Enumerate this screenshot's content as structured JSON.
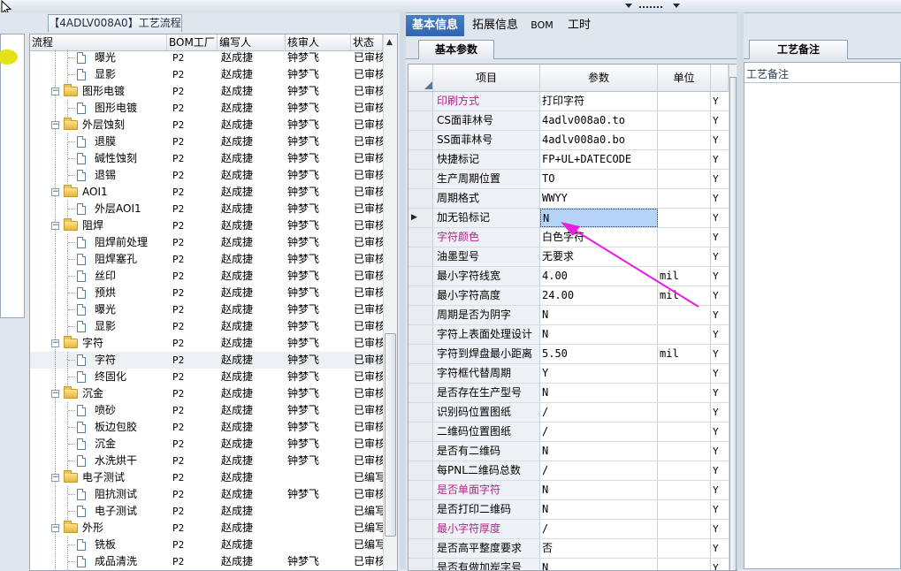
{
  "tree_caption": "【4ADLV008A0】工艺流程",
  "left_columns": [
    "流程",
    "BOM工厂",
    "编写人",
    "核审人",
    "状态"
  ],
  "tree_rows": [
    {
      "name": "曝光",
      "level": 2,
      "type": "doc",
      "bom": "P2",
      "writer": "赵成捷",
      "reviewer": "钟梦飞",
      "status": "已审核"
    },
    {
      "name": "显影",
      "level": 2,
      "type": "doc",
      "bom": "P2",
      "writer": "赵成捷",
      "reviewer": "钟梦飞",
      "status": "已审核"
    },
    {
      "name": "图形电镀",
      "level": 1,
      "type": "folder",
      "bom": "P2",
      "writer": "赵成捷",
      "reviewer": "钟梦飞",
      "status": "已审核"
    },
    {
      "name": "图形电镀",
      "level": 2,
      "type": "doc",
      "bom": "P2",
      "writer": "赵成捷",
      "reviewer": "钟梦飞",
      "status": "已审核"
    },
    {
      "name": "外层蚀刻",
      "level": 1,
      "type": "folder",
      "bom": "P2",
      "writer": "赵成捷",
      "reviewer": "钟梦飞",
      "status": "已审核"
    },
    {
      "name": "退膜",
      "level": 2,
      "type": "doc",
      "bom": "P2",
      "writer": "赵成捷",
      "reviewer": "钟梦飞",
      "status": "已审核"
    },
    {
      "name": "碱性蚀刻",
      "level": 2,
      "type": "doc",
      "bom": "P2",
      "writer": "赵成捷",
      "reviewer": "钟梦飞",
      "status": "已审核"
    },
    {
      "name": "退锡",
      "level": 2,
      "type": "doc",
      "bom": "P2",
      "writer": "赵成捷",
      "reviewer": "钟梦飞",
      "status": "已审核"
    },
    {
      "name": "AOI1",
      "level": 1,
      "type": "folder",
      "bom": "P2",
      "writer": "赵成捷",
      "reviewer": "钟梦飞",
      "status": "已审核"
    },
    {
      "name": "外层AOI1",
      "level": 2,
      "type": "doc",
      "bom": "P2",
      "writer": "赵成捷",
      "reviewer": "钟梦飞",
      "status": "已审核"
    },
    {
      "name": "阻焊",
      "level": 1,
      "type": "folder",
      "bom": "P2",
      "writer": "赵成捷",
      "reviewer": "钟梦飞",
      "status": "已审核"
    },
    {
      "name": "阻焊前处理",
      "level": 2,
      "type": "doc",
      "bom": "P2",
      "writer": "赵成捷",
      "reviewer": "钟梦飞",
      "status": "已审核"
    },
    {
      "name": "阻焊塞孔",
      "level": 2,
      "type": "doc",
      "bom": "P2",
      "writer": "赵成捷",
      "reviewer": "钟梦飞",
      "status": "已审核"
    },
    {
      "name": "丝印",
      "level": 2,
      "type": "doc",
      "bom": "P2",
      "writer": "赵成捷",
      "reviewer": "钟梦飞",
      "status": "已审核"
    },
    {
      "name": "预烘",
      "level": 2,
      "type": "doc",
      "bom": "P2",
      "writer": "赵成捷",
      "reviewer": "钟梦飞",
      "status": "已审核"
    },
    {
      "name": "曝光",
      "level": 2,
      "type": "doc",
      "bom": "P2",
      "writer": "赵成捷",
      "reviewer": "钟梦飞",
      "status": "已审核"
    },
    {
      "name": "显影",
      "level": 2,
      "type": "doc",
      "bom": "P2",
      "writer": "赵成捷",
      "reviewer": "钟梦飞",
      "status": "已审核"
    },
    {
      "name": "字符",
      "level": 1,
      "type": "folder",
      "bom": "P2",
      "writer": "赵成捷",
      "reviewer": "钟梦飞",
      "status": "已审核"
    },
    {
      "name": "字符",
      "level": 2,
      "type": "doc",
      "bom": "P2",
      "writer": "赵成捷",
      "reviewer": "钟梦飞",
      "status": "已审核",
      "selected": true
    },
    {
      "name": "终固化",
      "level": 2,
      "type": "doc",
      "bom": "P2",
      "writer": "赵成捷",
      "reviewer": "钟梦飞",
      "status": "已审核"
    },
    {
      "name": "沉金",
      "level": 1,
      "type": "folder",
      "bom": "P2",
      "writer": "赵成捷",
      "reviewer": "钟梦飞",
      "status": "已审核"
    },
    {
      "name": "喷砂",
      "level": 2,
      "type": "doc",
      "bom": "P2",
      "writer": "赵成捷",
      "reviewer": "钟梦飞",
      "status": "已审核"
    },
    {
      "name": "板边包胶",
      "level": 2,
      "type": "doc",
      "bom": "P2",
      "writer": "赵成捷",
      "reviewer": "钟梦飞",
      "status": "已审核"
    },
    {
      "name": "沉金",
      "level": 2,
      "type": "doc",
      "bom": "P2",
      "writer": "赵成捷",
      "reviewer": "钟梦飞",
      "status": "已审核"
    },
    {
      "name": "水洗烘干",
      "level": 2,
      "type": "doc",
      "bom": "P2",
      "writer": "赵成捷",
      "reviewer": "钟梦飞",
      "status": "已审核"
    },
    {
      "name": "电子测试",
      "level": 1,
      "type": "folder",
      "bom": "P2",
      "writer": "赵成捷",
      "reviewer": "",
      "status": "已编写"
    },
    {
      "name": "阻抗测试",
      "level": 2,
      "type": "doc",
      "bom": "P2",
      "writer": "赵成捷",
      "reviewer": "钟梦飞",
      "status": "已审核"
    },
    {
      "name": "电子测试",
      "level": 2,
      "type": "doc",
      "bom": "P2",
      "writer": "赵成捷",
      "reviewer": "",
      "status": "已编写"
    },
    {
      "name": "外形",
      "level": 1,
      "type": "folder",
      "bom": "P2",
      "writer": "赵成捷",
      "reviewer": "",
      "status": "已编写"
    },
    {
      "name": "铣板",
      "level": 2,
      "type": "doc",
      "bom": "P2",
      "writer": "赵成捷",
      "reviewer": "",
      "status": "已编写"
    },
    {
      "name": "成品清洗",
      "level": 2,
      "type": "doc",
      "bom": "P2",
      "writer": "赵成捷",
      "reviewer": "钟梦飞",
      "status": "已审核"
    }
  ],
  "main_tabs": [
    "基本信息",
    "拓展信息",
    "BOM",
    "工时"
  ],
  "sub_tab": "基本参数",
  "param_columns": [
    "项目",
    "参数",
    "单位"
  ],
  "params": [
    {
      "name": "印刷方式",
      "value": "打印字符",
      "unit": "",
      "flag": "Y",
      "pink": true,
      "mono": false
    },
    {
      "name": "CS面菲林号",
      "value": "4adlv008a0.to",
      "unit": "",
      "flag": "Y",
      "pink": false,
      "mono": true
    },
    {
      "name": "SS面菲林号",
      "value": "4adlv008a0.bo",
      "unit": "",
      "flag": "Y",
      "pink": false,
      "mono": true
    },
    {
      "name": "快捷标记",
      "value": "FP+UL+DATECODE",
      "unit": "",
      "flag": "Y",
      "pink": false,
      "mono": true
    },
    {
      "name": "生产周期位置",
      "value": "TO",
      "unit": "",
      "flag": "Y",
      "pink": false,
      "mono": true
    },
    {
      "name": "周期格式",
      "value": "WWYY",
      "unit": "",
      "flag": "Y",
      "pink": false,
      "mono": true
    },
    {
      "name": "加无铅标记",
      "value": "N",
      "unit": "",
      "flag": "Y",
      "pink": false,
      "mono": true,
      "selected": true
    },
    {
      "name": "字符颜色",
      "value": "白色字符",
      "unit": "",
      "flag": "Y",
      "pink": true,
      "mono": false
    },
    {
      "name": "油墨型号",
      "value": "无要求",
      "unit": "",
      "flag": "Y",
      "pink": false,
      "mono": false
    },
    {
      "name": "最小字符线宽",
      "value": "4.00",
      "unit": "mil",
      "flag": "Y",
      "pink": false,
      "mono": true
    },
    {
      "name": "最小字符高度",
      "value": "24.00",
      "unit": "mil",
      "flag": "Y",
      "pink": false,
      "mono": true
    },
    {
      "name": "周期是否为阴字",
      "value": "N",
      "unit": "",
      "flag": "Y",
      "pink": false,
      "mono": true
    },
    {
      "name": "字符上表面处理设计",
      "value": "N",
      "unit": "",
      "flag": "Y",
      "pink": false,
      "mono": true
    },
    {
      "name": "字符到焊盘最小距离",
      "value": "5.50",
      "unit": "mil",
      "flag": "Y",
      "pink": false,
      "mono": true
    },
    {
      "name": "字符框代替周期",
      "value": "Y",
      "unit": "",
      "flag": "Y",
      "pink": false,
      "mono": true
    },
    {
      "name": "是否存在生产型号",
      "value": "N",
      "unit": "",
      "flag": "Y",
      "pink": false,
      "mono": true
    },
    {
      "name": "识别码位置图纸",
      "value": "/",
      "unit": "",
      "flag": "Y",
      "pink": false,
      "mono": true
    },
    {
      "name": "二维码位置图纸",
      "value": "/",
      "unit": "",
      "flag": "Y",
      "pink": false,
      "mono": true
    },
    {
      "name": "是否有二维码",
      "value": "N",
      "unit": "",
      "flag": "Y",
      "pink": false,
      "mono": true
    },
    {
      "name": "每PNL二维码总数",
      "value": "/",
      "unit": "",
      "flag": "Y",
      "pink": false,
      "mono": true
    },
    {
      "name": "是否单面字符",
      "value": "N",
      "unit": "",
      "flag": "Y",
      "pink": true,
      "mono": true
    },
    {
      "name": "是否打印二维码",
      "value": "N",
      "unit": "",
      "flag": "Y",
      "pink": false,
      "mono": true
    },
    {
      "name": "最小字符厚度",
      "value": "/",
      "unit": "",
      "flag": "Y",
      "pink": true,
      "mono": true
    },
    {
      "name": "是否高平整度要求",
      "value": "否",
      "unit": "",
      "flag": "Y",
      "pink": false,
      "mono": false
    },
    {
      "name": "是否有做加炭字号",
      "value": "N",
      "unit": "",
      "flag": "Y",
      "pink": false,
      "mono": true
    }
  ],
  "notes_tab": "工艺备注",
  "notes_label": "工艺备注",
  "colors": {
    "accent_tab": "#3a72bb",
    "pink_label": "#b0278a",
    "arrow": "#e81ee0"
  }
}
